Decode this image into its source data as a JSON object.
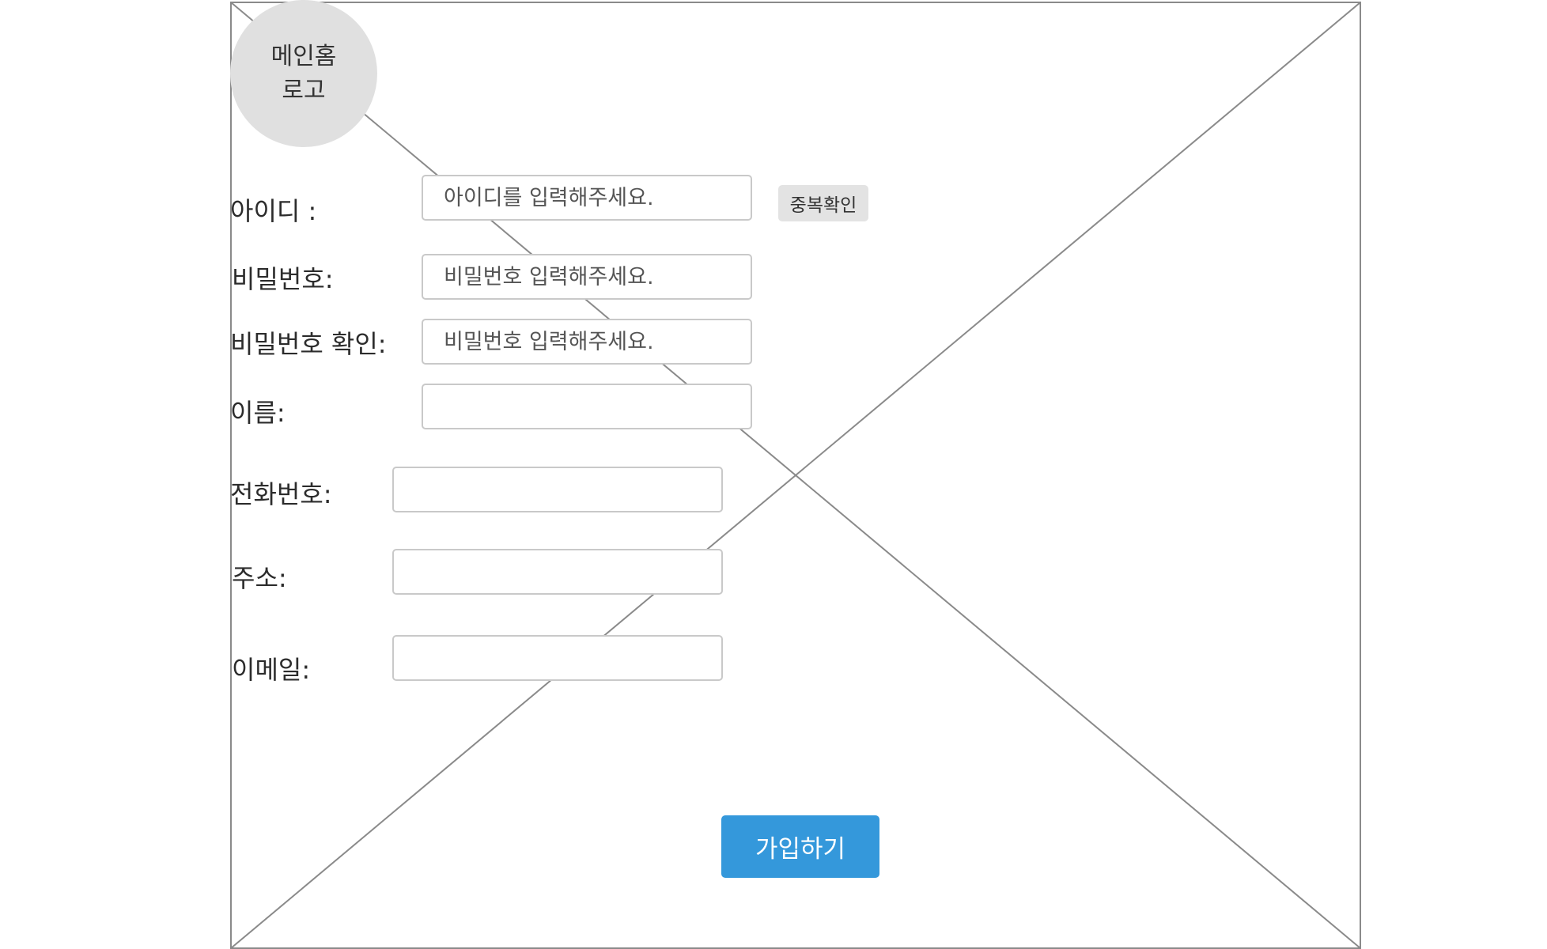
{
  "logo": {
    "text": "메인홈\n로고"
  },
  "form": {
    "fields": [
      {
        "label": "아이디 :",
        "placeholder": "아이디를 입력해주세요.",
        "value": ""
      },
      {
        "label": "비밀번호:",
        "placeholder": "비밀번호 입력해주세요.",
        "value": ""
      },
      {
        "label": "비밀번호 확인:",
        "placeholder": "비밀번호 입력해주세요.",
        "value": ""
      },
      {
        "label": "이름:",
        "placeholder": "",
        "value": ""
      },
      {
        "label": "전화번호:",
        "placeholder": "",
        "value": ""
      },
      {
        "label": "주소:",
        "placeholder": "",
        "value": ""
      },
      {
        "label": "이메일:",
        "placeholder": "",
        "value": ""
      }
    ],
    "duplicate_check_label": "중복확인",
    "submit_label": "가입하기"
  },
  "colors": {
    "submit_button": "#3498db",
    "logo_circle": "#e0e0e0",
    "duplicate_button": "#e3e3e3",
    "frame_border": "#8a8a8a"
  }
}
